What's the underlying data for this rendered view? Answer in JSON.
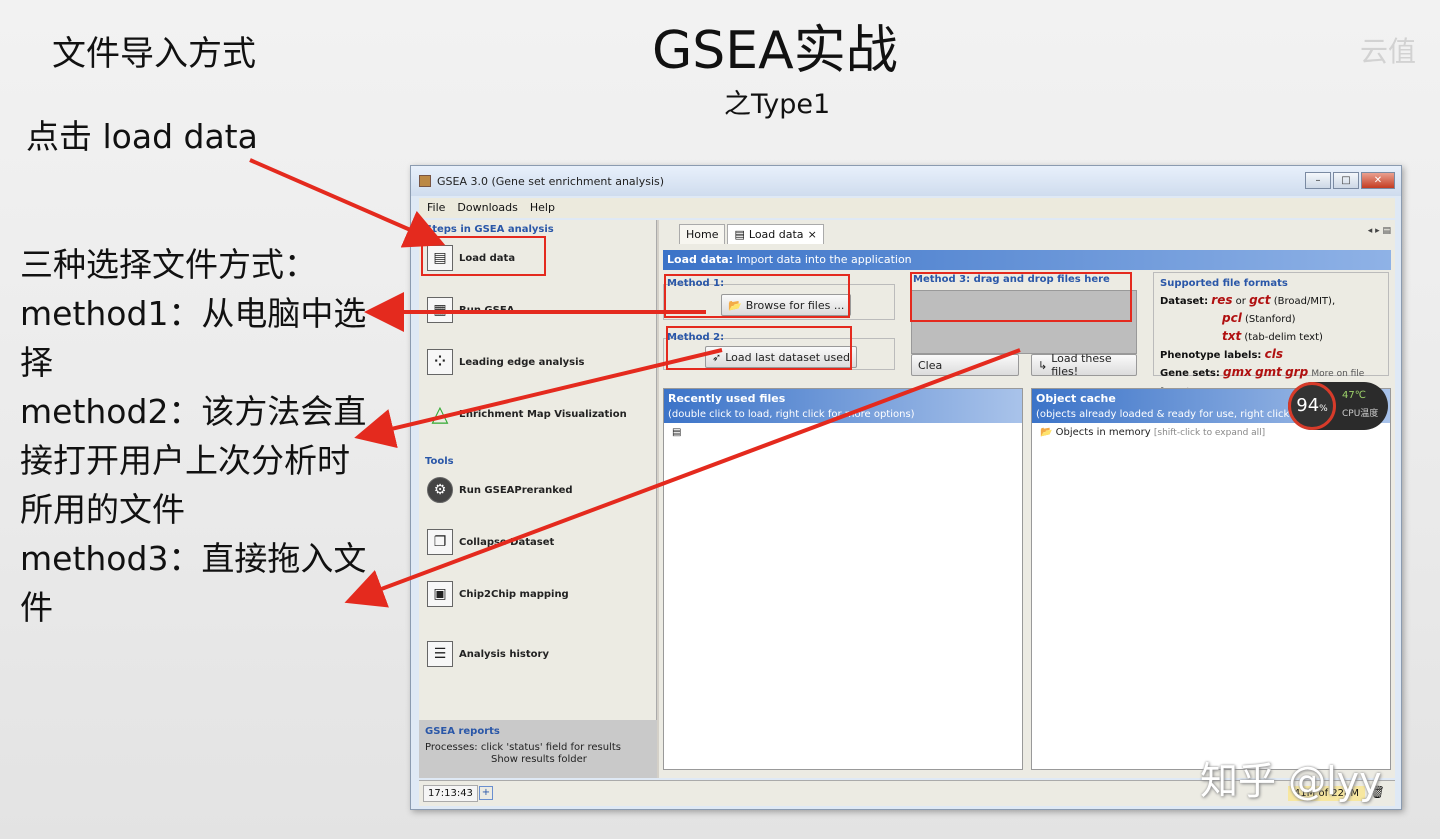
{
  "slide": {
    "title": "GSEA实战",
    "subtitle": "之Type1",
    "corner_label": "文件导入方式",
    "note_click": "点击 load data",
    "note_methods": "三种选择文件方式：",
    "note_m1": "method1：从电脑中选择",
    "note_m2": "method2：该方法会直接打开用户上次分析时所用的文件",
    "note_m3": "method3：直接拖入文件",
    "faint_text": "云值",
    "watermark": "知乎 @lyy",
    "arrow_color": "#e42a1e"
  },
  "window": {
    "title": "GSEA 3.0 (Gene set enrichment analysis)",
    "menu": [
      "File",
      "Downloads",
      "Help"
    ],
    "steps_header": "Steps in GSEA analysis",
    "steps": [
      {
        "label": "Load data",
        "icon": "load-data-icon"
      },
      {
        "label": "Run GSEA",
        "icon": "run-gsea-icon"
      },
      {
        "label": "Leading edge analysis",
        "icon": "leading-edge-icon"
      },
      {
        "label": "Enrichment Map Visualization",
        "icon": "enrichment-map-icon"
      }
    ],
    "tools_header": "Tools",
    "tools": [
      {
        "label": "Run GSEAPreranked",
        "icon": "gear-icon"
      },
      {
        "label": "Collapse Dataset",
        "icon": "collapse-icon"
      },
      {
        "label": "Chip2Chip mapping",
        "icon": "chip-icon"
      }
    ],
    "history": "Analysis history",
    "reports": {
      "title": "GSEA reports",
      "processes": "Processes: click 'status' field for results",
      "show_folder": "Show results folder"
    },
    "tabs": [
      "Home",
      "Load data"
    ],
    "tab_close": "×",
    "banner_bold": "Load data:",
    "banner_text": "Import data into the application",
    "method1": {
      "label": "Method 1:",
      "button": "Browse for files ..."
    },
    "method2": {
      "label": "Method 2:",
      "button": "Load last dataset used"
    },
    "method3": {
      "label": "Method 3: drag and drop files here",
      "clear": "Clea",
      "load": "Load these files!"
    },
    "formats": {
      "title": "Supported file formats",
      "dataset_label": "Dataset:",
      "res": "res",
      "or": "or",
      "gct": "gct",
      "gct_note": "(Broad/MIT),",
      "pcl": "pcl",
      "pcl_note": "(Stanford)",
      "txt": "txt",
      "txt_note": "(tab-delim text)",
      "phenotype": "Phenotype labels:",
      "cls": "cls",
      "genesets": "Gene sets:",
      "gmx": "gmx",
      "gmt": "gmt",
      "grp": "grp",
      "more": "More on file formats..."
    },
    "recent": {
      "title": "Recently used files",
      "hint": "(double click to load, right click for more options)"
    },
    "cache": {
      "title": "Object cache",
      "hint": "(objects already loaded & ready for use, right click",
      "item": "Objects in memory",
      "item_hint": "[shift-click to expand all]"
    },
    "status": {
      "time": "17:13:43",
      "memory": "41M of 228M"
    }
  },
  "cpu": {
    "percent": "94",
    "unit": "%",
    "temp": "47℃",
    "label": "CPU温度"
  }
}
